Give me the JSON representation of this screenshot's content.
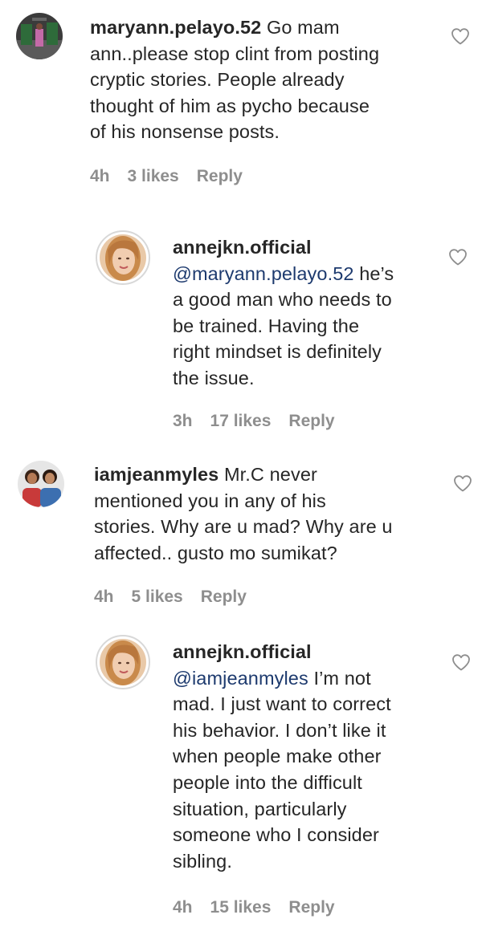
{
  "comments": [
    {
      "username": "maryann.pelayo.52",
      "mention": "",
      "lines": [
        "Go mam",
        "ann..please stop clint from posting",
        "cryptic stories. People already",
        "thought of him as pycho because",
        "of his nonsense posts."
      ],
      "time": "4h",
      "likes": "3 likes",
      "reply": "Reply"
    },
    {
      "username": "annejkn.official",
      "mention": "@maryann.pelayo.52",
      "lines": [
        "he’s",
        "a good man who needs to",
        "be trained. Having the",
        "right mindset is definitely",
        "the issue."
      ],
      "time": "3h",
      "likes": "17 likes",
      "reply": "Reply"
    },
    {
      "username": "iamjeanmyles",
      "mention": "",
      "lines": [
        "Mr.C never",
        "mentioned you in any of his",
        "stories. Why are u mad? Why are u",
        "affected.. gusto mo sumikat?"
      ],
      "time": "4h",
      "likes": "5 likes",
      "reply": "Reply"
    },
    {
      "username": "annejkn.official",
      "mention": "@iamjeanmyles",
      "lines": [
        "I’m not",
        "mad. I just want to correct",
        "his behavior. I don’t like it",
        "when people make other",
        "people into the difficult",
        "situation, particularly",
        "someone who I consider",
        "sibling."
      ],
      "time": "4h",
      "likes": "15 likes",
      "reply": "Reply"
    }
  ],
  "colors": {
    "text": "#262626",
    "meta": "#8e8e8e",
    "mention": "#1d3a6e"
  },
  "icons": {
    "like": "heart-outline-icon"
  }
}
